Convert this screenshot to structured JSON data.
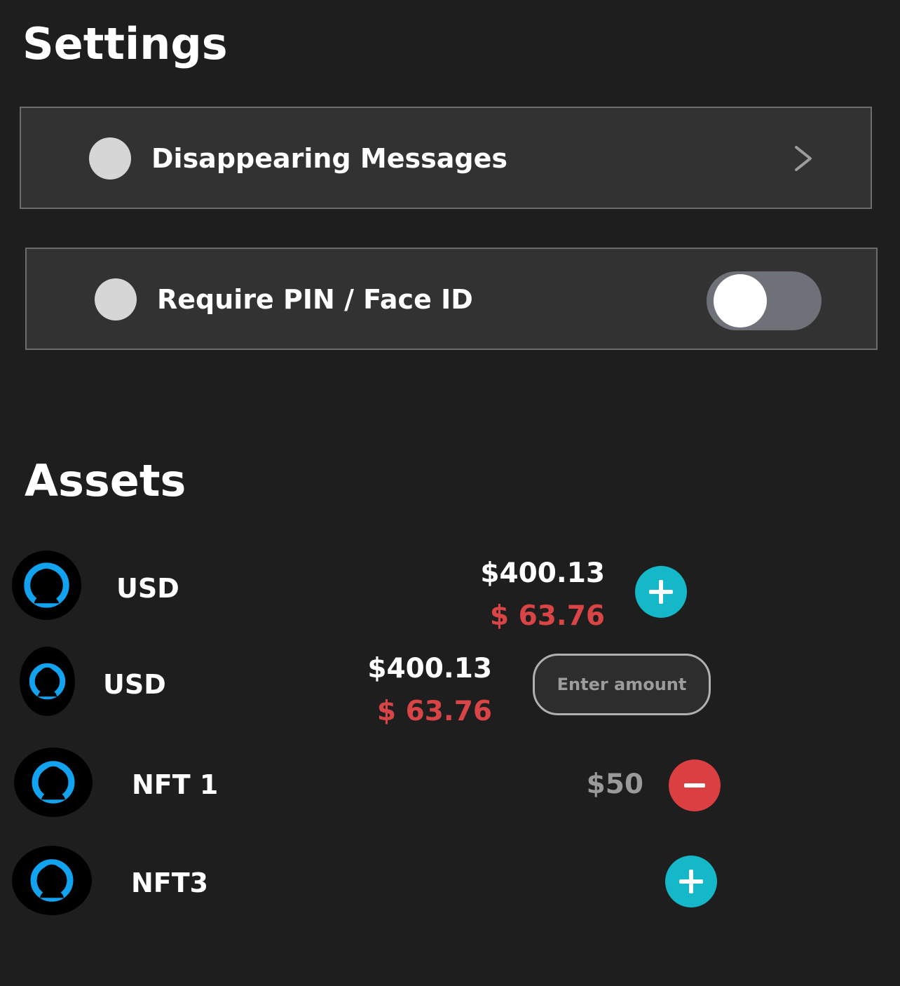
{
  "settings": {
    "title": "Settings",
    "disappearing_messages": {
      "label": "Disappearing Messages"
    },
    "require_pin": {
      "label": "Require PIN / Face ID",
      "enabled": false
    }
  },
  "assets": {
    "title": "Assets",
    "rows": [
      {
        "name": "USD",
        "value": "$400.13",
        "change": "$ 63.76",
        "action": "add"
      },
      {
        "name": "USD",
        "value": "$400.13",
        "change": "$ 63.76",
        "amount_placeholder": "Enter amount"
      },
      {
        "name": "NFT 1",
        "value": "$50",
        "action": "remove"
      },
      {
        "name": "NFT3",
        "action": "add"
      }
    ]
  },
  "colors": {
    "background": "#1e1e1e",
    "row_background": "#323232",
    "accent_add": "#14b8c8",
    "accent_remove": "#dc3f42",
    "change_text": "#d94447",
    "avatar_ring": "#12a3f0"
  },
  "icons": {
    "chevron": "chevron-right-icon",
    "add": "plus-icon",
    "remove": "minus-icon",
    "avatar": "user-silhouette-icon"
  }
}
